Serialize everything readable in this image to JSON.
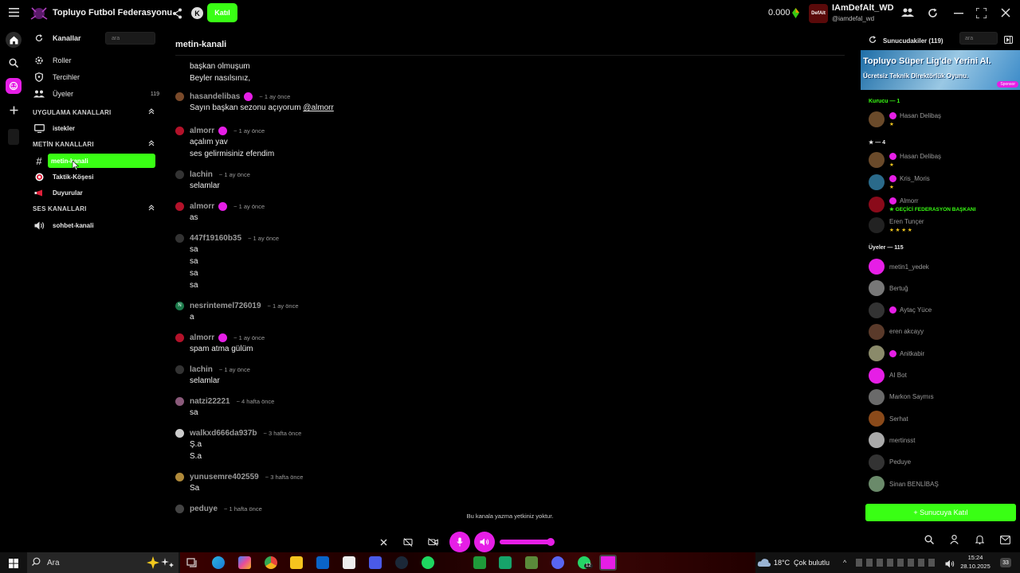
{
  "app": {
    "title": "Topluyo Futbol Federasyonu",
    "join_button": "Katıl"
  },
  "account": {
    "balance": "0.000",
    "display_name": "IAmDefAlt_WD",
    "handle": "@iamdefal_wd",
    "avatar_text": "DefAlt"
  },
  "sidebar": {
    "channels_label": "Kanallar",
    "search_placeholder": "ara",
    "menu": [
      {
        "label": "Roller"
      },
      {
        "label": "Tercihler"
      },
      {
        "label": "Üyeler",
        "count": "119"
      }
    ],
    "app_section": "UYGULAMA KANALLARI",
    "app_channels": [
      "istekler"
    ],
    "text_section": "METİN KANALLARI",
    "text_channels": [
      "metin-kanali",
      "Taktik-Köşesi",
      "Duyurular"
    ],
    "voice_section": "SES KANALLARI",
    "voice_channels": [
      "sohbet-kanali"
    ]
  },
  "chat": {
    "channel_title": "metin-kanali",
    "intro_lines": [
      "başkan olmuşum",
      "Beyler nasılsınız,"
    ],
    "messages": [
      {
        "user": "hasandelibas",
        "time": "~ 1 ay önce",
        "text_prefix": "Sayın başkan sezonu açıyorum ",
        "mention": "@almorr",
        "badge": true,
        "avatar_color": "#7a4a2a"
      },
      {
        "user": "almorr",
        "time": "~ 1 ay önce",
        "lines": [
          "açalım yav",
          "ses gelirmisiniz efendim"
        ],
        "badge": true,
        "avatar_color": "#b3122a"
      },
      {
        "user": "lachin",
        "time": "~ 1 ay önce",
        "lines": [
          "selamlar"
        ],
        "badge": false,
        "avatar_color": "#333333"
      },
      {
        "user": "almorr",
        "time": "~ 1 ay önce",
        "lines": [
          "as"
        ],
        "badge": true,
        "avatar_color": "#b3122a"
      },
      {
        "user": "447f19160b35",
        "time": "~ 1 ay önce",
        "lines": [
          "sa",
          "sa",
          "sa",
          "sa"
        ],
        "badge": false,
        "avatar_color": "#333333"
      },
      {
        "user": "nesrintemel726019",
        "time": "~ 1 ay önce",
        "lines": [
          "a"
        ],
        "badge": false,
        "avatar_color": "#1b7a4a",
        "initial": "N"
      },
      {
        "user": "almorr",
        "time": "~ 1 ay önce",
        "lines": [
          "spam atma gülüm"
        ],
        "badge": true,
        "avatar_color": "#b3122a"
      },
      {
        "user": "lachin",
        "time": "~ 1 ay önce",
        "lines": [
          "selamlar"
        ],
        "badge": false,
        "avatar_color": "#333333"
      },
      {
        "user": "natzi22221",
        "time": "~ 4 hafta önce",
        "lines": [
          "sa"
        ],
        "badge": false,
        "avatar_color": "#8a5a7a"
      },
      {
        "user": "walkxd666da937b",
        "time": "~ 3 hafta önce",
        "lines": [
          "Ş.a",
          "S.a"
        ],
        "badge": false,
        "avatar_color": "#cccccc"
      },
      {
        "user": "yunusemre402559",
        "time": "~ 3 hafta önce",
        "lines": [
          "Sa"
        ],
        "badge": false,
        "avatar_color": "#b08a3a"
      },
      {
        "user": "peduye",
        "time": "~ 1 hafta önce",
        "lines": [],
        "badge": false,
        "avatar_color": "#444444"
      }
    ],
    "no_permission": "Bu kanala yazma yetkiniz yoktur."
  },
  "members_panel": {
    "title": "Sunucudakiler (119)",
    "search_placeholder": "ara",
    "ad_line1": "Topluyo Süper Lig'de Yerini Al.",
    "ad_line2": "Ücretsiz Teknik Direktörlük Oyunu.",
    "ad_tag": "Sponsor",
    "founder_group": "Kurucu — 1",
    "founders": [
      {
        "name": "Hasan Delibaş",
        "sub": "★"
      }
    ],
    "star_group": "★ — 4",
    "star_members": [
      {
        "name": "Hasan Delibaş",
        "sub": "★"
      },
      {
        "name": "Kris_Moris",
        "sub": "★"
      },
      {
        "name": "Almorr",
        "sub": "★ GEÇİCİ FEDERASYON BAŞKANI"
      },
      {
        "name": "Eren Tunçer",
        "sub": "★ ★ ★ ★"
      }
    ],
    "member_group": "Üyeler — 115",
    "members": [
      "metin1_yedek",
      "Bertuğ",
      "Aytaç Yüce",
      "eren akcayy",
      "Anitkabir",
      "AI Bot",
      "Markon Saymıs",
      "Serhat",
      "mertinsst",
      "Peduye",
      "Sinan BENLİBAŞ"
    ],
    "join_server": "+ Sunucuya Katıl"
  },
  "taskbar": {
    "search": "Ara",
    "weather_temp": "18°C",
    "weather_text": "Çok bulutlu",
    "time": "15:24",
    "date": "28.10.2025",
    "badge": "33",
    "app_badge": "12"
  },
  "colors": {
    "accent_green": "#39ff14",
    "accent_magenta": "#e61ee6",
    "background": "#000000"
  }
}
